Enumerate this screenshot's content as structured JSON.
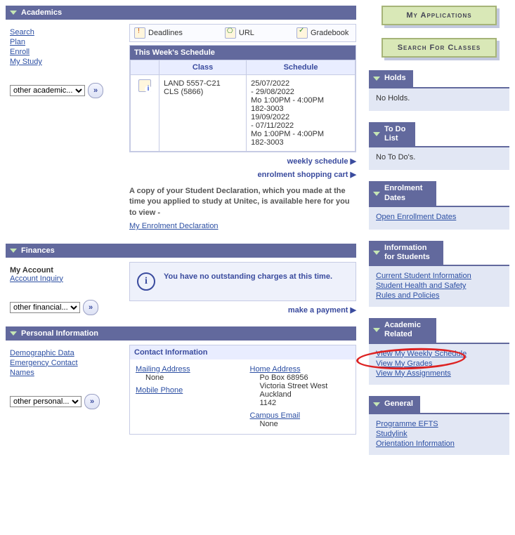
{
  "academics": {
    "title": "Academics",
    "links": {
      "search": "Search",
      "plan": "Plan",
      "enroll": "Enroll",
      "mystudy": "My Study"
    },
    "dropdown": "other academic...",
    "toolbar": {
      "deadlines": "Deadlines",
      "url": "URL",
      "gradebook": "Gradebook"
    },
    "schedule_title": "This Week's Schedule",
    "th_class": "Class",
    "th_schedule": "Schedule",
    "rows": [
      {
        "class": "LAND 5557-C21\nCLS (5866)",
        "schedule": "25/07/2022\n- 29/08/2022\nMo 1:00PM - 4:00PM\n182-3003\n19/09/2022\n- 07/11/2022\nMo 1:00PM - 4:00PM\n182-3003"
      }
    ],
    "weekly_link": "weekly schedule",
    "cart_link": "enrolment shopping cart",
    "declaration_text": "A copy of your Student Declaration, which you made at the time you applied to study at Unitec, is available here for you to view -",
    "declaration_link": "My Enrolment Declaration"
  },
  "finances": {
    "title": "Finances",
    "account_heading": "My Account",
    "account_link": "Account Inquiry",
    "dropdown": "other financial...",
    "message": "You have no outstanding charges at this time.",
    "payment_link": "make a payment"
  },
  "personal": {
    "title": "Personal Information",
    "links": {
      "demo": "Demographic Data",
      "emerg": "Emergency Contact",
      "names": "Names"
    },
    "dropdown": "other personal...",
    "contact_title": "Contact Information",
    "mailing_label": "Mailing Address",
    "mailing_value": "None",
    "mobile_label": "Mobile Phone",
    "home_label": "Home Address",
    "home_value": "Po Box 68956\nVictoria Street West\nAuckland\n1142",
    "campus_label": "Campus Email",
    "campus_value": "None"
  },
  "right": {
    "btn1": "My Applications",
    "btn2": "Search For Classes",
    "holds": {
      "title": "Holds",
      "body": "No Holds."
    },
    "todo": {
      "title": "To Do List",
      "body": "No To Do's."
    },
    "enroll": {
      "title": "Enrolment Dates",
      "link1": "Open Enrollment Dates"
    },
    "info": {
      "title": "Information for Students",
      "link1": "Current Student Information",
      "link2": "Student Health and Safety",
      "link3": "Rules and Policies"
    },
    "acad": {
      "title": "Academic Related",
      "link1": "View My Weekly Schedule",
      "link2": "View My Grades",
      "link3": "View My Assignments"
    },
    "general": {
      "title": "General",
      "link1": "Programme EFTS",
      "link2": "Studylink",
      "link3": "Orientation Information"
    }
  }
}
